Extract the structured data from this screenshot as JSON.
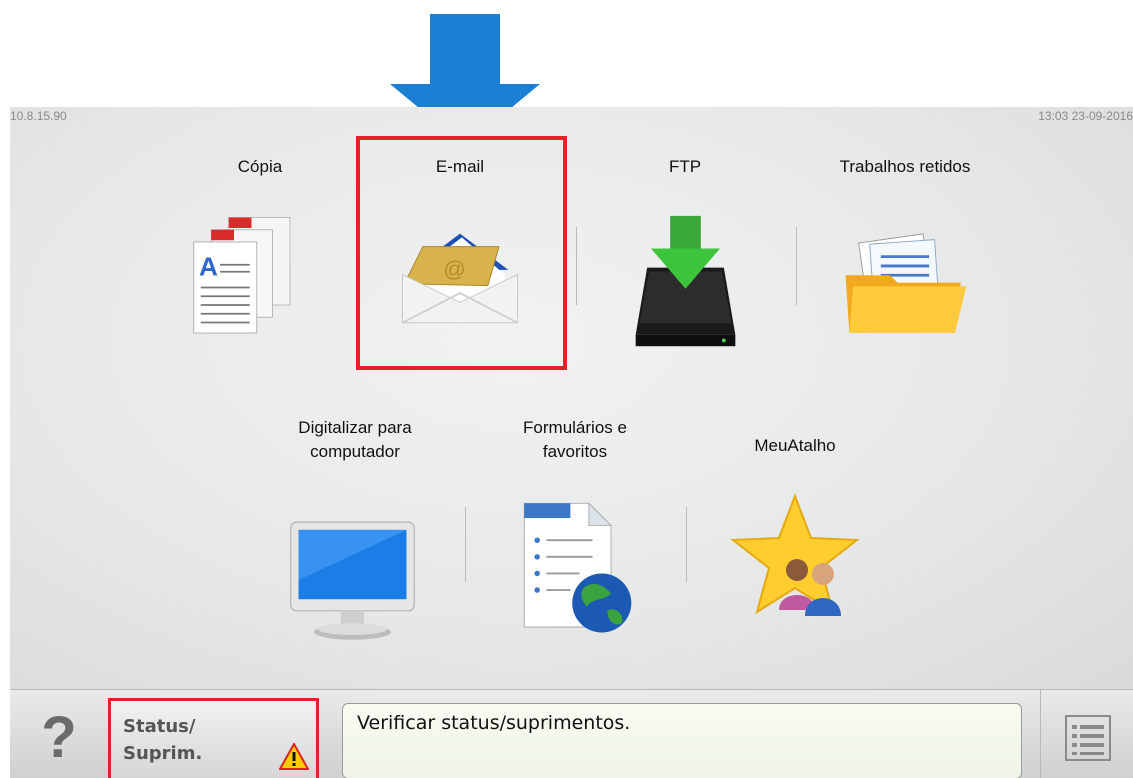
{
  "header": {
    "ip_address": "10.8.15.90",
    "datetime": "13:03 23-09-2016"
  },
  "tiles": [
    {
      "label": "Cópia",
      "icon": "copy-document-icon"
    },
    {
      "label": "E-mail",
      "icon": "email-envelope-icon"
    },
    {
      "label": "FTP",
      "icon": "ftp-drive-icon"
    },
    {
      "label": "Trabalhos retidos",
      "icon": "held-jobs-folder-icon"
    },
    {
      "label": "Digitalizar para\ncomputador",
      "icon": "computer-monitor-icon"
    },
    {
      "label": "Formulários e\nfavoritos",
      "icon": "forms-globe-icon"
    },
    {
      "label": "MeuAtalho",
      "icon": "star-people-icon"
    }
  ],
  "bottombar": {
    "help_label": "?",
    "status_label": "Status/\nSuprim.",
    "status_message": "Verificar status/suprimentos.",
    "menu_icon": "menu-list-icon"
  },
  "colors": {
    "highlight": "#e4202a",
    "arrow": "#1b7fd3"
  }
}
